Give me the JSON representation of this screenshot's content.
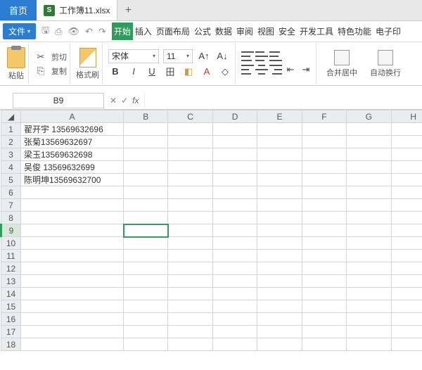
{
  "titlebar": {
    "home": "首页",
    "doc": "工作簿11.xlsx",
    "xls_badge": "S",
    "new_tab": "+"
  },
  "menubar": {
    "file": "文件",
    "tabs": [
      "开始",
      "插入",
      "页面布局",
      "公式",
      "数据",
      "审阅",
      "视图",
      "安全",
      "开发工具",
      "特色功能",
      "电子印"
    ]
  },
  "ribbon": {
    "paste": "粘贴",
    "cut": "剪切",
    "copy": "复制",
    "fmt_paint": "格式刷",
    "font": "宋体",
    "size": "11",
    "merge": "合并居中",
    "wrap": "自动换行"
  },
  "fx": {
    "namebox": "B9",
    "fx": "fx"
  },
  "columns": [
    "A",
    "B",
    "C",
    "D",
    "E",
    "F",
    "G",
    "H"
  ],
  "rows": 18,
  "selected": {
    "row": 9,
    "col": "B"
  },
  "cells": {
    "A1": "翟开宇 13569632696",
    "A2": "张菊13569632697",
    "A3": "梁玉13569632698",
    "A4": "吴俊 13569632699",
    "A5": "陈明坤13569632700"
  }
}
